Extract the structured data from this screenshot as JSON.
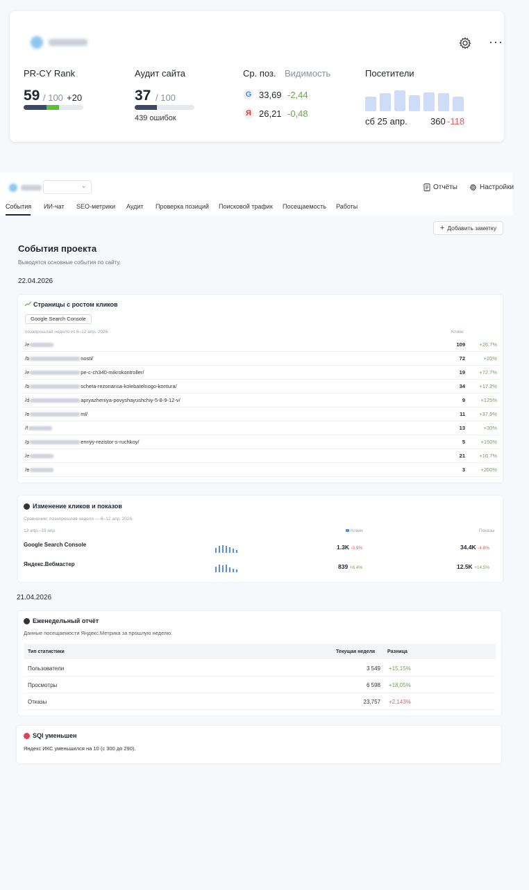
{
  "summary": {
    "rank": {
      "label": "PR-CY Rank",
      "value": "59",
      "max": "/ 100",
      "delta": "+20",
      "progress": 0.59
    },
    "audit": {
      "label": "Аудит сайта",
      "value": "37",
      "max": "/ 100",
      "errors": "439 ошибок",
      "progress": 0.37
    },
    "positions": {
      "label": "Ср. поз.",
      "visibility_label": "Видимость",
      "google": {
        "icon": "G",
        "value": "33,69",
        "delta": "-2,44"
      },
      "yandex": {
        "icon": "Я",
        "value": "26,21",
        "delta": "-0,48"
      }
    },
    "visitors": {
      "label": "Посетители",
      "date": "сб 25 апр.",
      "value": "360",
      "delta": "-118",
      "bars": [
        0.7,
        0.85,
        1.0,
        0.75,
        0.9,
        0.85,
        0.7
      ]
    }
  },
  "project": {
    "links": {
      "reports": "Отчёты",
      "settings": "Настройки"
    },
    "tabs": [
      "События",
      "ИИ-чат",
      "SEO-метрики",
      "Аудит",
      "Проверка позиций",
      "Поисковой трафик",
      "Посещаемость",
      "Работы"
    ],
    "add_note": "Добавить заметку",
    "title": "События проекта",
    "subtitle": "Выводятся основные события по сайту."
  },
  "date1": "22.04.2026",
  "clicks_growth": {
    "title": "Страницы с ростом кликов",
    "badge": "Google Search Console",
    "period": "позапрошлая неделя vs 6–12 апр. 2026",
    "col": "Клики",
    "rows": [
      {
        "pre": "/e",
        "post": "",
        "clicks": "109",
        "diff": "+26.7%"
      },
      {
        "pre": "/b",
        "post": "nosti/",
        "clicks": "72",
        "diff": "+20%"
      },
      {
        "pre": "/e",
        "post": "pe-c-ch340-mikrokontroller/",
        "clicks": "19",
        "diff": "+72.7%"
      },
      {
        "pre": "/b",
        "post": "scheta-rezonansa-kolebatelnogo-kontura/",
        "clicks": "34",
        "diff": "+17.2%"
      },
      {
        "pre": "/d",
        "post": "apryazheniya-povyshayushchiy-5-8-9-12-v/",
        "clicks": "9",
        "diff": "+125%"
      },
      {
        "pre": "/e",
        "post": "ml/",
        "clicks": "11",
        "diff": "+37.5%"
      },
      {
        "pre": "/f",
        "post": "",
        "clicks": "13",
        "diff": "+30%"
      },
      {
        "pre": "/p",
        "post": "ennyy-rezistor-s-ruchkoy/",
        "clicks": "5",
        "diff": "+150%"
      },
      {
        "pre": "/e",
        "post": "",
        "clicks": "21",
        "diff": "+16.7%"
      },
      {
        "pre": "/e",
        "post": "",
        "clicks": "3",
        "diff": "+200%"
      }
    ]
  },
  "clicks_change": {
    "title": "Изменение кликов и показов",
    "compare": "Сравнение: позапрошлая неделя — 6–12 апр. 2026",
    "period": "13 апр.–19 апр.",
    "col_clicks": "Клики",
    "col_impr": "Показы",
    "sources": [
      {
        "name": "Google Search Console",
        "clicks": "1.3K",
        "clicks_diff": "-0.9%",
        "impr": "34.4K",
        "impr_diff": "-4.8%",
        "spark": [
          0.6,
          0.8,
          0.9,
          0.8,
          0.7,
          0.5,
          0.3
        ]
      },
      {
        "name": "Яндекс.Вебмастер",
        "clicks": "839",
        "clicks_diff": "+8.4%",
        "impr": "12.5K",
        "impr_diff": "+14.5%",
        "spark": [
          0.7,
          0.9,
          0.8,
          0.9,
          0.6,
          0.4,
          0.3
        ]
      }
    ]
  },
  "date2": "21.04.2026",
  "weekly": {
    "title": "Еженедельный отчёт",
    "subtitle": "Данные посещаемости Яндекс.Метрика за прошлую неделю.",
    "headers": [
      "Тип статистики",
      "Текущая неделя",
      "Разница"
    ],
    "rows": [
      {
        "type": "Пользователи",
        "value": "3 549",
        "diff": "+15,15%"
      },
      {
        "type": "Просмотры",
        "value": "6 598",
        "diff": "+18,05%"
      },
      {
        "type": "Отказы",
        "value": "23,757",
        "diff": "+2,143%"
      }
    ]
  },
  "sqi": {
    "title": "SQI уменьшен",
    "text": "Яндекс ИКС уменьшился на 10 (с 300 до 290)."
  },
  "colors": {
    "green": "#6aa84f",
    "red": "#e06060",
    "rank_bar": "#5cbf3a",
    "bar_dark": "#3b4a6b",
    "visitor_bar": "#cfdcf7"
  }
}
